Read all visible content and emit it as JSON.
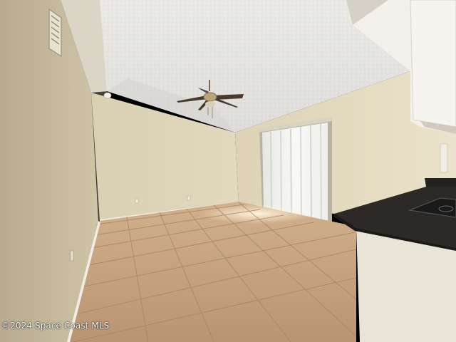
{
  "photo": {
    "watermark": "©2024 Space Coast MLS"
  }
}
